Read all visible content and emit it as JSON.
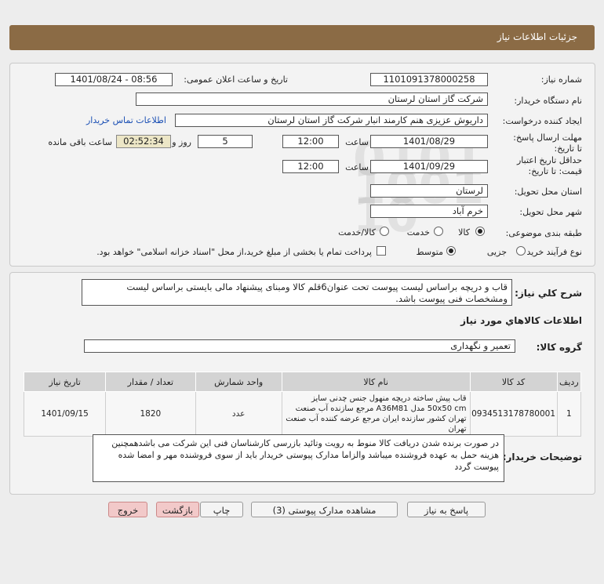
{
  "header": {
    "title": "جزئیات اطلاعات نیاز"
  },
  "form": {
    "need_number_label": "شماره نیاز:",
    "need_number": "1101091378000258",
    "announce_label": "تاریخ و ساعت اعلان عمومی:",
    "announce_value": "1401/08/24 - 08:56",
    "buyer_label": "نام دستگاه خریدار:",
    "buyer_value": "شرکت گاز استان لرستان",
    "creator_label": "ایجاد کننده درخواست:",
    "creator_value": "داریوش عزیزی هنم کارمند انبار شرکت گاز استان لرستان",
    "contact_link": "اطلاعات تماس خریدار",
    "deadline_label": "مهلت ارسال پاسخ: تا تاریخ:",
    "deadline_date": "1401/08/29",
    "time_label": "ساعت",
    "deadline_time": "12:00",
    "days_value": "5",
    "days_label": "روز و",
    "remaining_time": "02:52:34",
    "remaining_label": "ساعت باقی مانده",
    "validity_label": "حداقل تاریخ اعتبار قیمت: تا تاریخ:",
    "validity_date": "1401/09/29",
    "validity_time": "12:00",
    "province_label": "استان محل تحویل:",
    "province_value": "لرستان",
    "city_label": "شهر محل تحویل:",
    "city_value": "خرم آباد",
    "category_label": "طبقه بندی موضوعی:",
    "category_options": [
      "کالا",
      "خدمت",
      "کالا/خدمت"
    ],
    "category_selected": "کالا",
    "process_label": "نوع فرآیند خرید :",
    "process_options": [
      "جزیی",
      "متوسط"
    ],
    "process_selected": "متوسط",
    "payment_note": "پرداخت تمام یا بخشی از مبلغ خرید،از محل \"اسناد خزانه اسلامی\" خواهد بود."
  },
  "description": {
    "label": "شرح کلي نياز:",
    "text": "قاب و دریچه براساس لیست پیوست تحت عنوان6قلم کالا ومبنای پیشنهاد مالی بایستی براساس لیست ومشخصات فنی پیوست باشد."
  },
  "goods": {
    "section_title": "اطلاعات کالاهاي مورد نياز",
    "group_label": "گروه کالا:",
    "group_value": "تعمیر و نگهداری",
    "columns": [
      "ردیف",
      "کد کالا",
      "نام کالا",
      "واحد شمارش",
      "تعداد / مقدار",
      "تاریخ نیاز"
    ],
    "rows": [
      {
        "index": "1",
        "code": "0934513178780001",
        "name": "قاب پیش ساخته دریچه منهول جنس چدنی سایز 50x50 cm مدل A36M81 مرجع سازنده آب صنعت تهران کشور سازنده ایران مرجع عرضه کننده آب صنعت تهران",
        "unit": "عدد",
        "quantity": "1820",
        "date": "1401/09/15"
      }
    ]
  },
  "buyer_notes": {
    "label": "توضیحات خریدار:",
    "text": "در صورت برنده شدن دریافت کالا منوط به رویت وتائید بازرسی کارشناسان فنی این شرکت می باشدهمچنین هزینه حمل به عهده فروشنده میباشد والزاما مدارک پیوستی خریدار باید از سوی فروشنده مهر و امضا شده پیوست گردد"
  },
  "buttons": {
    "reply": "پاسخ به نیاز",
    "view_docs": "مشاهده مدارک پیوستی (3)",
    "print": "چاپ",
    "back": "بازگشت",
    "exit": "خروج"
  },
  "watermark": {
    "brand": "ParsNamadData",
    "line1": "مرکز فراوری اطلاعات پارس نماد داده ها",
    "line2": "پایگاه اطلاع رسانی مناقصات و مزایدات",
    "line3": "۰۲۱-۸۸۳۴۹۶۷۰"
  },
  "colors": {
    "header_bg": "#8b6b45",
    "timer_bg": "#ece6c6",
    "link": "#1a4fb4"
  }
}
